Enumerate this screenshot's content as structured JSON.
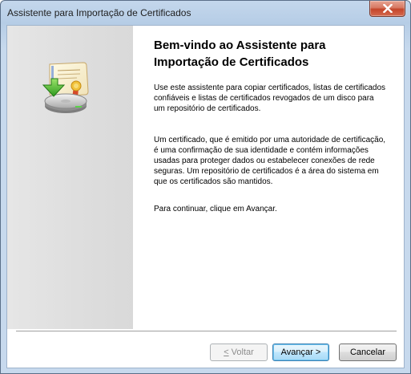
{
  "window": {
    "title": "Assistente para Importação de Certificados",
    "close_icon": "close-icon"
  },
  "left_panel": {
    "icon": "certificate-import-icon"
  },
  "content": {
    "heading_line1": "Bem-vindo ao Assistente para",
    "heading_line2": "Importação de Certificados",
    "paragraph1": "Use este assistente para copiar certificados, listas de certificados confiáveis e listas de certificados revogados de um disco para um repositório de certificados.",
    "paragraph2": "Um certificado, que é emitido por uma autoridade de certificação, é uma confirmação de sua identidade e contém informações usadas para proteger dados ou estabelecer conexões de rede seguras. Um repositório de certificados é a área do sistema em que os certificados são mantidos.",
    "paragraph3": "Para continuar, clique em Avançar."
  },
  "buttons": {
    "back_mnemonic": "<",
    "back_rest": " Voltar",
    "next_label": "Avançar >",
    "cancel_label": "Cancelar"
  },
  "colors": {
    "title_bar": "#b6cde6",
    "close_button": "#c4462a",
    "left_panel": "#dedede",
    "default_button_border": "#3c7fb1"
  }
}
